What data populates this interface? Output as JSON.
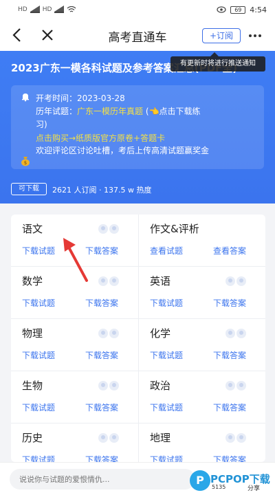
{
  "status_bar": {
    "time": "4:54",
    "battery": "69",
    "left_labels": [
      "HD",
      "HD"
    ]
  },
  "nav": {
    "title": "高考直通车",
    "subscribe_label": "+订阅"
  },
  "tooltip": "有更新时将进行推送通知",
  "hero": {
    "title": "2023广东一模各科试题及参考答案汇总(PDF全)",
    "exam_time_label": "开考时间：",
    "exam_time_value": "2023-03-28",
    "past_papers_label": "历年试题：",
    "past_papers_link": "广东一模历年真题",
    "past_papers_hint_1": "点击下载练",
    "past_papers_hint_2": "习)",
    "purchase_text": "点击购买→纸质版官方原卷+答题卡",
    "comment_promo": "欢迎评论区讨论吐槽，考后上传高清试题赢奖金",
    "download_tag": "可下载",
    "stats": "2621 人订阅 · 137.5 w 热度"
  },
  "subjects": [
    {
      "name": "语文",
      "left_link": "下载试题",
      "right_link": "下载答案"
    },
    {
      "name": "作文&评析",
      "left_link": "查看试题",
      "right_link": "查看答案"
    },
    {
      "name": "数学",
      "left_link": "下载试题",
      "right_link": "下载答案"
    },
    {
      "name": "英语",
      "left_link": "下载试题",
      "right_link": "下载答案"
    },
    {
      "name": "物理",
      "left_link": "下载试题",
      "right_link": "下载答案"
    },
    {
      "name": "化学",
      "left_link": "下载试题",
      "right_link": "下载答案"
    },
    {
      "name": "生物",
      "left_link": "下载试题",
      "right_link": "下载答案"
    },
    {
      "name": "政治",
      "left_link": "下载试题",
      "right_link": "下载答案"
    },
    {
      "name": "历史",
      "left_link": "下载试题",
      "right_link": "下载答案"
    },
    {
      "name": "地理",
      "left_link": "下载试题",
      "right_link": "下载答案"
    }
  ],
  "bottom": {
    "comment_placeholder": "说说你与试题的爱恨情仇...",
    "share_label": "分享",
    "watermark_text": "PCPOP下载",
    "watermark_sub": "5135"
  },
  "colors": {
    "primary": "#3b74ee",
    "highlight": "#f3e046",
    "annotation_arrow": "#e53935"
  }
}
